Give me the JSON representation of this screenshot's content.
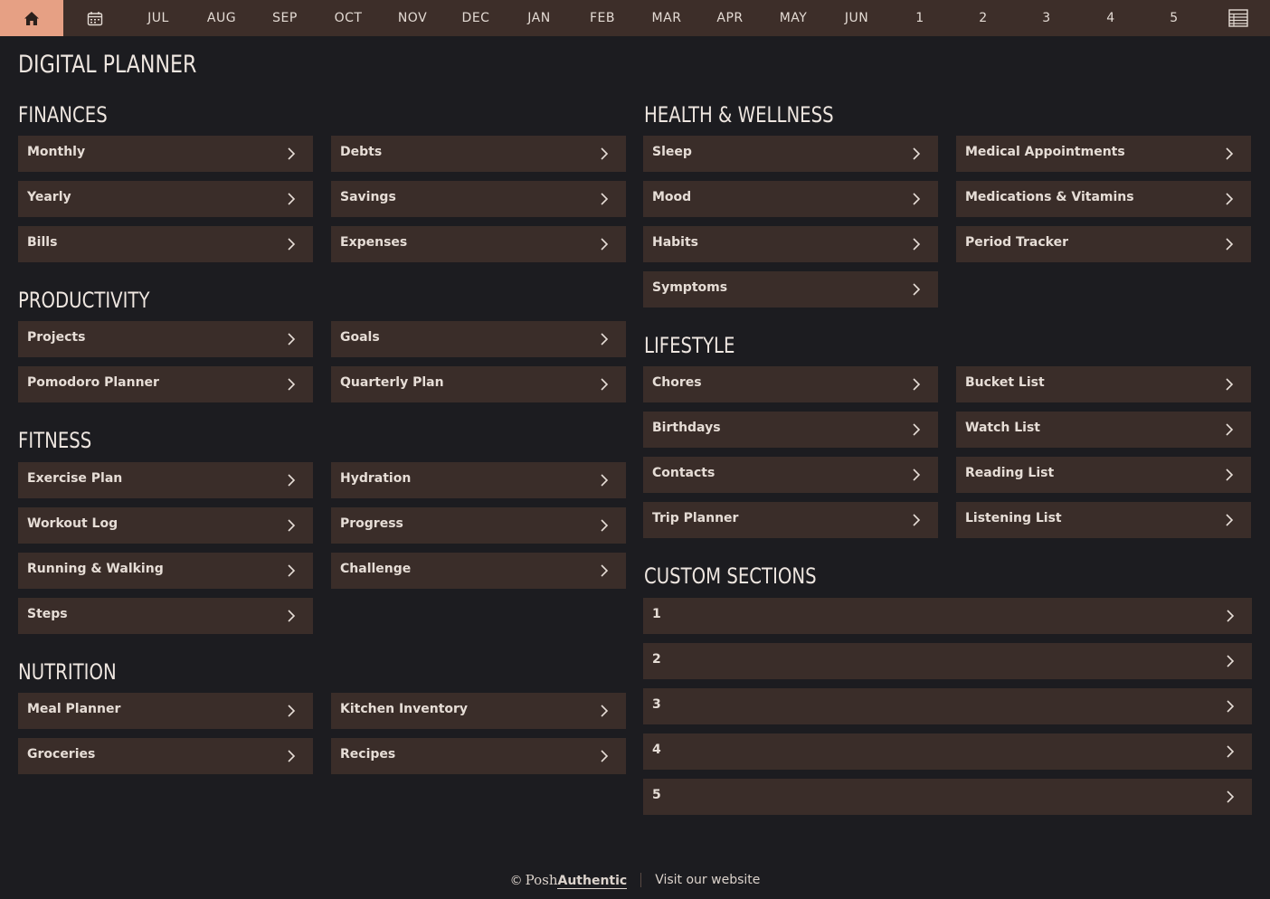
{
  "nav": {
    "months": [
      "JUL",
      "AUG",
      "SEP",
      "OCT",
      "NOV",
      "DEC",
      "JAN",
      "FEB",
      "MAR",
      "APR",
      "MAY",
      "JUN"
    ],
    "numbers": [
      "1",
      "2",
      "3",
      "4",
      "5"
    ]
  },
  "page_title": "DIGITAL PLANNER",
  "sections": {
    "finances": {
      "title": "FINANCES",
      "items": [
        "Monthly",
        "Debts",
        "Yearly",
        "Savings",
        "Bills",
        "Expenses"
      ]
    },
    "productivity": {
      "title": "PRODUCTIVITY",
      "items": [
        "Projects",
        "Goals",
        "Pomodoro Planner",
        "Quarterly Plan"
      ]
    },
    "fitness": {
      "title": "FITNESS",
      "items": [
        "Exercise Plan",
        "Hydration",
        "Workout Log",
        "Progress",
        "Running & Walking",
        "Challenge",
        "Steps"
      ]
    },
    "nutrition": {
      "title": "NUTRITION",
      "items": [
        "Meal Planner",
        "Kitchen Inventory",
        "Groceries",
        "Recipes"
      ]
    },
    "health": {
      "title": "HEALTH & WELLNESS",
      "items": [
        "Sleep",
        "Medical Appointments",
        "Mood",
        "Medications & Vitamins",
        "Habits",
        "Period Tracker",
        "Symptoms"
      ]
    },
    "lifestyle": {
      "title": "LIFESTYLE",
      "items": [
        "Chores",
        "Bucket List",
        "Birthdays",
        "Watch List",
        "Contacts",
        "Reading List",
        "Trip Planner",
        "Listening List"
      ]
    },
    "custom": {
      "title": "CUSTOM SECTIONS",
      "items": [
        "1",
        "2",
        "3",
        "4",
        "5"
      ]
    }
  },
  "footer": {
    "copyright_symbol": "©",
    "brand_posh": "Posh",
    "brand_authentic": "Authentic",
    "visit_link": "Visit our website"
  },
  "colors": {
    "background": "#1c1c20",
    "topbar": "#3d2e29",
    "accent": "#e6a084",
    "button": "#3a2d29"
  }
}
